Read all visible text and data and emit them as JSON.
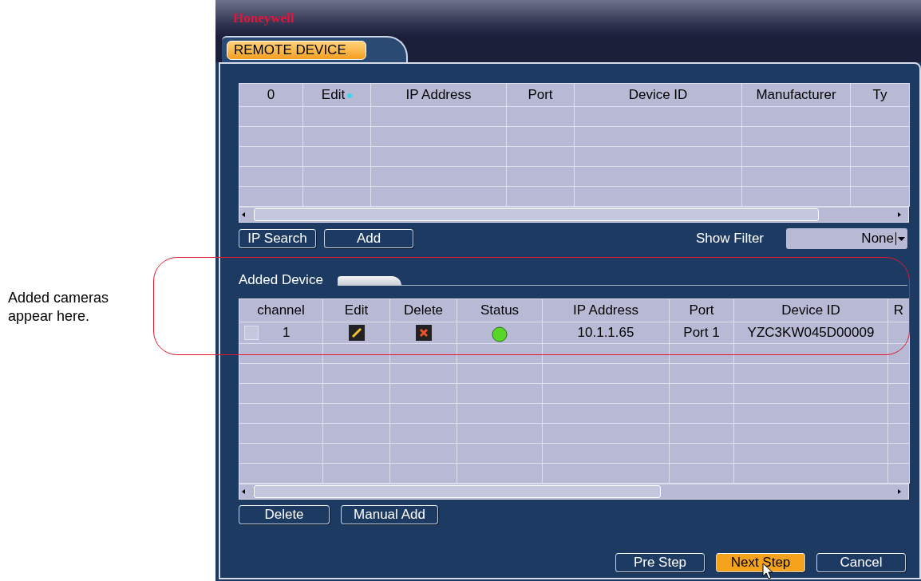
{
  "annotation": {
    "text": "Added cameras appear here."
  },
  "window": {
    "logo": "Honeywell"
  },
  "tabs": [
    {
      "label": "REMOTE DEVICE",
      "selected": true
    }
  ],
  "search_table": {
    "columns": [
      "0",
      "Edit",
      "IP Address",
      "Port",
      "Device ID",
      "Manufacturer",
      "Ty"
    ]
  },
  "search_buttons": [
    "IP Search",
    "Add"
  ],
  "filter": {
    "label": "Show Filter",
    "value": "None"
  },
  "added_section": {
    "title": "Added Device"
  },
  "added_table": {
    "columns": [
      "channel",
      "Edit",
      "Delete",
      "Status",
      "IP Address",
      "Port",
      "Device ID",
      "R"
    ],
    "rows": [
      {
        "checked": false,
        "channel": "1",
        "online": true,
        "ip": "10.1.1.65",
        "port": "Port 1",
        "device_id": "YZC3KW045D00009"
      }
    ]
  },
  "added_buttons": [
    "Delete",
    "Manual Add"
  ],
  "footer_buttons": [
    {
      "label": "Pre Step",
      "highlighted": false
    },
    {
      "label": "Next Step",
      "highlighted": true
    },
    {
      "label": "Cancel",
      "highlighted": false
    }
  ]
}
